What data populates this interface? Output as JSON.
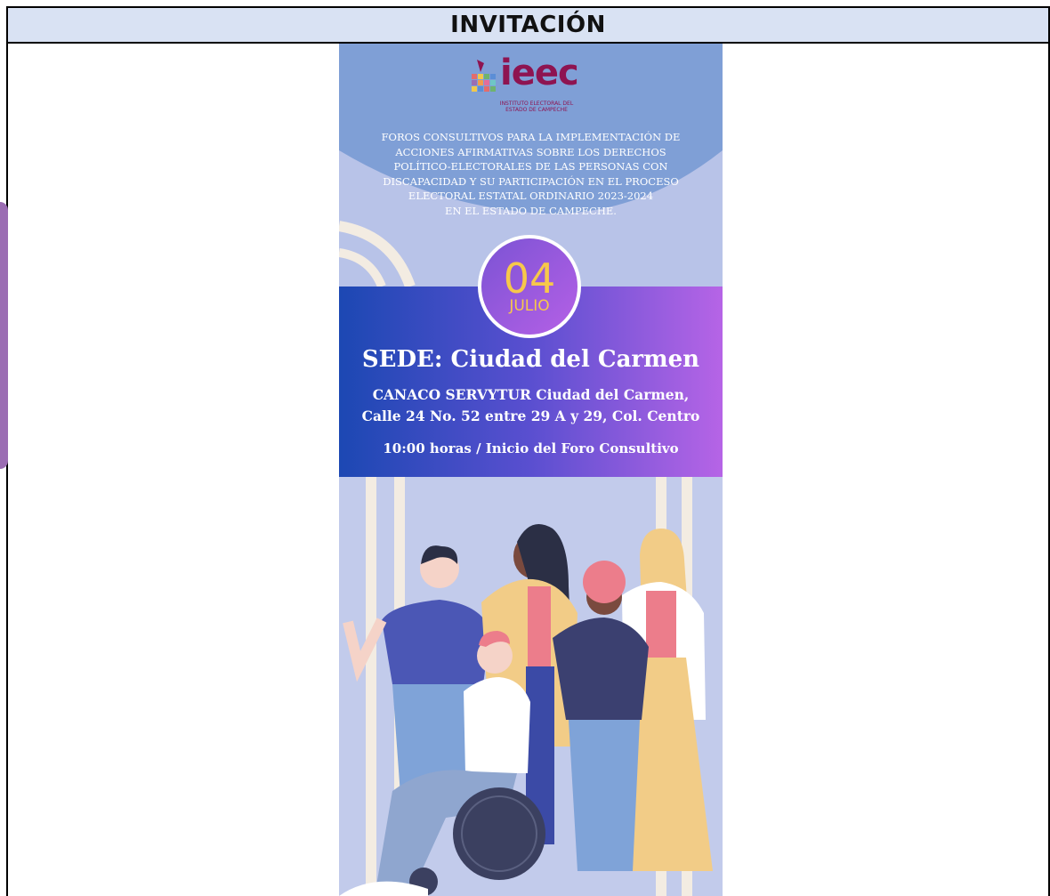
{
  "header": {
    "title": "INVITACIÓN"
  },
  "poster": {
    "logo": {
      "brand": "ieec",
      "subtitle": "INSTITUTO ELECTORAL DEL ESTADO DE CAMPECHE"
    },
    "forum_lines": [
      "FOROS CONSULTIVOS PARA LA IMPLEMENTACIÓN DE",
      "ACCIONES AFIRMATIVAS SOBRE LOS DERECHOS",
      "POLÍTICO-ELECTORALES DE LAS PERSONAS CON",
      "DISCAPACIDAD Y SU PARTICIPACIÓN EN EL PROCESO",
      "ELECTORAL ESTATAL ORDINARIO 2023-2024",
      "EN EL ESTADO DE CAMPECHE."
    ],
    "date": {
      "day": "04",
      "month": "JULIO"
    },
    "venue": {
      "title": "SEDE: Ciudad del Carmen",
      "address_line1": "CANACO SERVYTUR Ciudad del Carmen,",
      "address_line2": "Calle 24 No. 52 entre 29 A y 29, Col. Centro",
      "time": "10:00 horas / Inicio del Foro Consultivo"
    },
    "colors": {
      "brand": "#8e1451",
      "band_start": "#1c48b3",
      "band_end": "#b664e6",
      "date_text": "#f7c84a",
      "background": "#c5cbe9"
    }
  }
}
